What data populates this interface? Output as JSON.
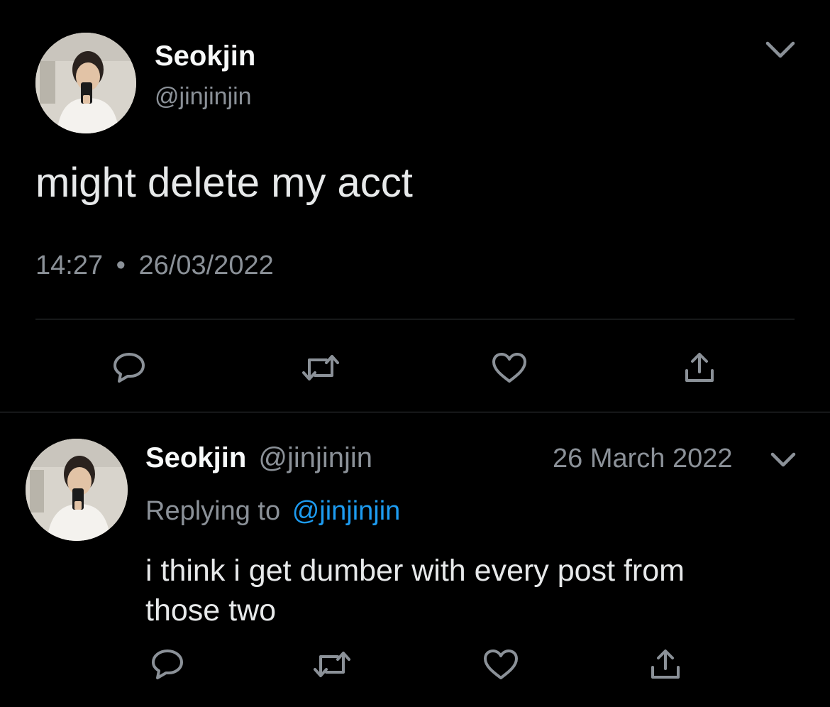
{
  "main_tweet": {
    "author_name": "Seokjin",
    "author_handle": "@jinjinjin",
    "text": "might delete my acct",
    "time": "14:27",
    "separator": "•",
    "date": "26/03/2022"
  },
  "reply_tweet": {
    "author_name": "Seokjin",
    "author_handle": "@jinjinjin",
    "date": "26 March 2022",
    "replying_prefix": "Replying to",
    "replying_handle": "@jinjinjin",
    "text_line1": "i think i get dumber with every post from",
    "text_line2": "those two"
  },
  "icons": {
    "reply": "reply-icon",
    "retweet": "retweet-icon",
    "like": "like-icon",
    "share": "share-icon",
    "more": "chevron-down-icon"
  },
  "colors": {
    "background": "#000000",
    "text": "#e7e9ea",
    "muted": "#8b9198",
    "link": "#1d9bf0",
    "divider": "#3a3d40"
  }
}
